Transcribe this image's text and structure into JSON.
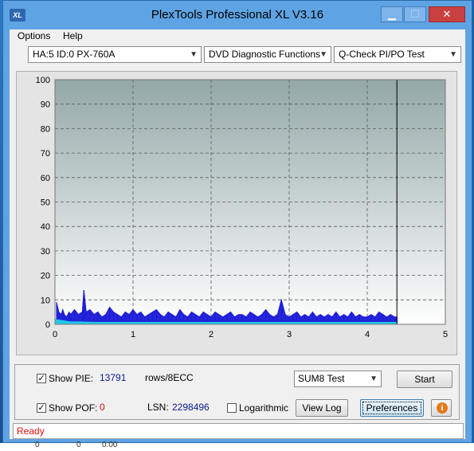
{
  "window": {
    "title": "PlexTools Professional XL V3.16",
    "icon_text": "XL",
    "controls": {
      "minimize": "▁",
      "maximize": "☐",
      "close": "✕"
    }
  },
  "menu": {
    "options": "Options",
    "help": "Help"
  },
  "toolbar": {
    "drive": "HA:5 ID:0  PX-760A",
    "function": "DVD Diagnostic Functions",
    "test": "Q-Check PI/PO Test"
  },
  "chart_data": {
    "type": "area",
    "title": "",
    "xlabel": "",
    "ylabel": "",
    "xlim": [
      0,
      5
    ],
    "ylim": [
      0,
      100
    ],
    "x_ticks": [
      "0",
      "1",
      "2",
      "3",
      "4",
      "5"
    ],
    "y_ticks": [
      "0",
      "10",
      "20",
      "30",
      "40",
      "50",
      "60",
      "70",
      "80",
      "90",
      "100"
    ],
    "grid": true,
    "end_marker_x": 4.38,
    "series": [
      {
        "color": "#1a1ad8",
        "x": [
          0.02,
          0.05,
          0.08,
          0.1,
          0.12,
          0.15,
          0.18,
          0.2,
          0.25,
          0.3,
          0.35,
          0.37,
          0.4,
          0.45,
          0.5,
          0.55,
          0.6,
          0.65,
          0.7,
          0.75,
          0.8,
          0.85,
          0.9,
          0.95,
          1.0,
          1.05,
          1.1,
          1.15,
          1.2,
          1.25,
          1.3,
          1.35,
          1.4,
          1.45,
          1.5,
          1.55,
          1.6,
          1.65,
          1.7,
          1.75,
          1.8,
          1.85,
          1.9,
          1.95,
          2.0,
          2.05,
          2.1,
          2.15,
          2.2,
          2.25,
          2.3,
          2.35,
          2.4,
          2.45,
          2.5,
          2.55,
          2.6,
          2.65,
          2.7,
          2.75,
          2.8,
          2.85,
          2.9,
          2.95,
          3.0,
          3.05,
          3.1,
          3.15,
          3.2,
          3.25,
          3.3,
          3.35,
          3.4,
          3.45,
          3.5,
          3.55,
          3.6,
          3.65,
          3.7,
          3.75,
          3.8,
          3.85,
          3.9,
          3.95,
          4.0,
          4.05,
          4.1,
          4.15,
          4.2,
          4.25,
          4.3,
          4.35,
          4.38
        ],
        "values": [
          9,
          5,
          4,
          6,
          4,
          3,
          5,
          4,
          6,
          4,
          5,
          14,
          5,
          6,
          4,
          5,
          3,
          4,
          7,
          5,
          4,
          3,
          5,
          4,
          6,
          4,
          5,
          3,
          4,
          5,
          6,
          4,
          3,
          5,
          4,
          3,
          6,
          4,
          3,
          5,
          4,
          3,
          5,
          4,
          3,
          5,
          4,
          3,
          4,
          5,
          3,
          4,
          4,
          3,
          5,
          4,
          3,
          4,
          6,
          4,
          3,
          4,
          10,
          4,
          3,
          4,
          5,
          3,
          4,
          3,
          5,
          3,
          4,
          3,
          4,
          3,
          5,
          3,
          4,
          3,
          5,
          3,
          4,
          3,
          3,
          4,
          3,
          5,
          4,
          3,
          4,
          3,
          3
        ]
      },
      {
        "color": "#20c8e8",
        "x": [
          0,
          0.1,
          0.2,
          0.3,
          0.5,
          1,
          1.5,
          2,
          2.5,
          3,
          3.5,
          4,
          4.38
        ],
        "values": [
          2,
          1.5,
          1,
          1,
          0.8,
          0.8,
          0.8,
          0.8,
          0.8,
          0.8,
          0.8,
          0.8,
          0.8
        ]
      }
    ]
  },
  "controls": {
    "show_pie": {
      "label": "Show PIE:",
      "checked": "✓",
      "value": "13791",
      "unit": "rows/8ECC"
    },
    "show_poe": {
      "label": "Show POF:",
      "checked": "✓",
      "value": "0"
    },
    "lsn": {
      "label": "LSN:",
      "value": "2298496"
    },
    "logarithmic": {
      "label": "Logarithmic"
    },
    "sum_test": "SUM8 Test",
    "start": "Start",
    "view_log": "View Log",
    "preferences": "Preferences",
    "info": "i"
  },
  "status": {
    "text": "Ready"
  },
  "desktop_bottom": [
    "0",
    "0",
    "0.00"
  ]
}
